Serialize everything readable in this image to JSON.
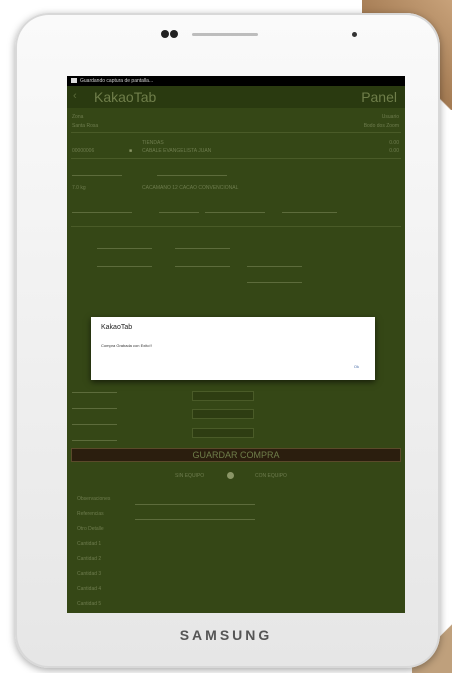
{
  "device": {
    "brand": "SAMSUNG"
  },
  "status_bar": {
    "text": "Guardando captura de pantalla..."
  },
  "app": {
    "title": "KakaoTab",
    "panel_label": "Panel"
  },
  "form": {
    "zone_label": "Zona",
    "zone_value": "Santa Rosa",
    "user_label": "Usuario",
    "user_value": "Bodo dos Zoom",
    "client_code": "00000006",
    "client_type": "TIENDAS",
    "client_name": "CABALE EVANGELISTA JUAN",
    "amount1": "0.00",
    "amount2": "0.00",
    "kg_value": "7.0 kg",
    "product": "CACAMANO 12 CACAO CONVENCIONAL",
    "button_label": "GUARDAR COMPRA",
    "radio_without": "SIN EQUIPO",
    "radio_with": "CON EQUIPO",
    "notes": [
      "Observaciones",
      "Referencias",
      "Otro Detalle",
      "Cantidad 1",
      "Cantidad 2",
      "Cantidad 3",
      "Cantidad 4",
      "Cantidad 5"
    ]
  },
  "dialog": {
    "title": "KakaoTab",
    "message": "Compra Grabada con Exito!!",
    "ok_label": "Ok"
  }
}
